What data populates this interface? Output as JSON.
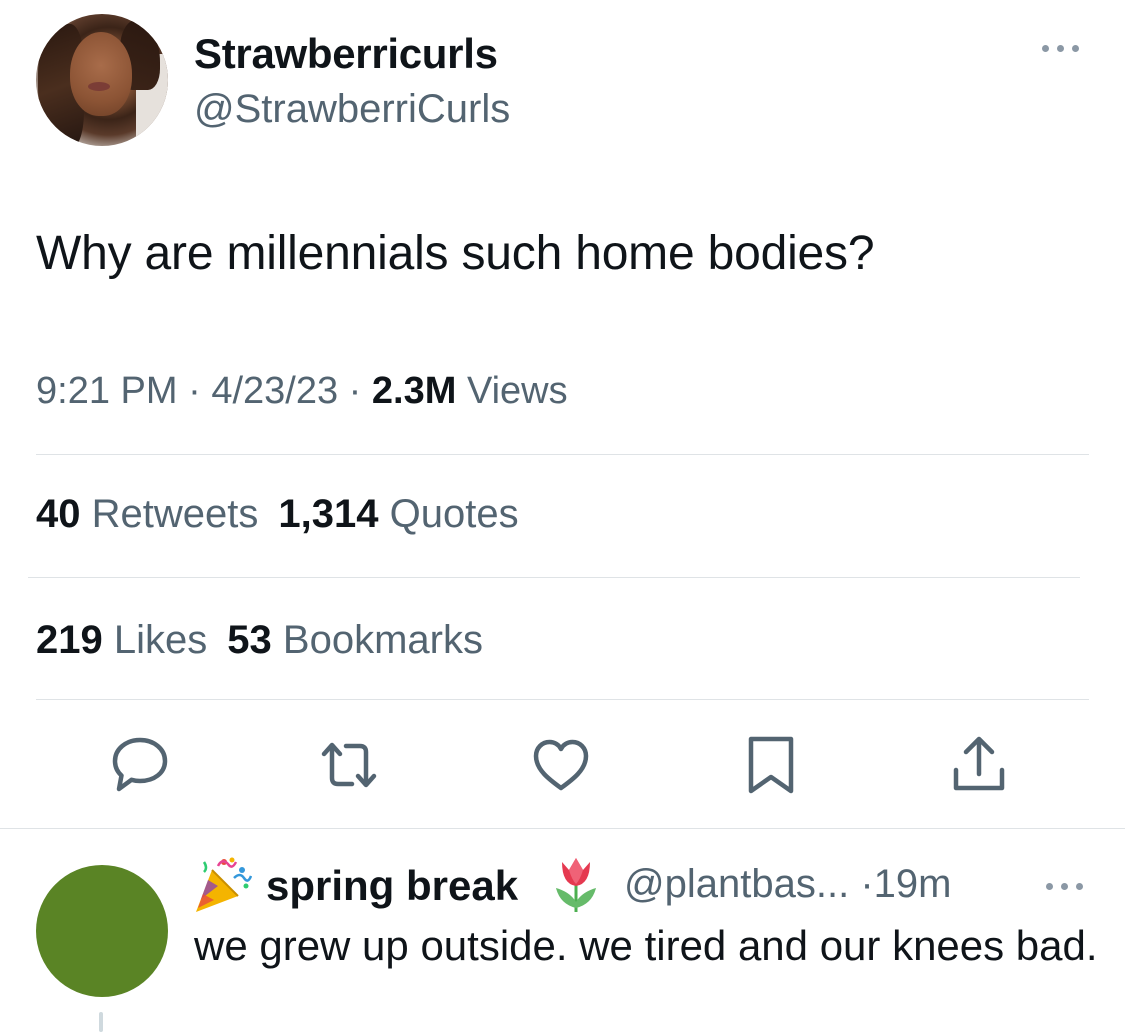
{
  "tweet": {
    "author_name": "Strawberricurls",
    "author_handle": "@StrawberriCurls",
    "text": "Why are millennials such home bodies?",
    "time": "9:21 PM",
    "date": "4/23/23",
    "views_count": "2.3M",
    "views_label": "Views",
    "separator": "·"
  },
  "stats": {
    "retweets_count": "40",
    "retweets_label": "Retweets",
    "quotes_count": "1,314",
    "quotes_label": "Quotes",
    "likes_count": "219",
    "likes_label": "Likes",
    "bookmarks_count": "53",
    "bookmarks_label": "Bookmarks"
  },
  "actions": [
    "reply-icon",
    "retweet-icon",
    "like-icon",
    "bookmark-icon",
    "share-icon"
  ],
  "reply": {
    "author_name": "spring break",
    "author_handle": "@plantbas...",
    "separator": "·",
    "time": "19m",
    "text": "we grew up outside. we tired and our knees bad.",
    "avatar_color": "#5a8425",
    "icons": [
      "party-popper-icon",
      "tulip-icon"
    ]
  },
  "colors": {
    "text_primary": "#0f1419",
    "text_secondary": "#536471",
    "divider": "#dfe3e6",
    "icon": "#536471"
  }
}
